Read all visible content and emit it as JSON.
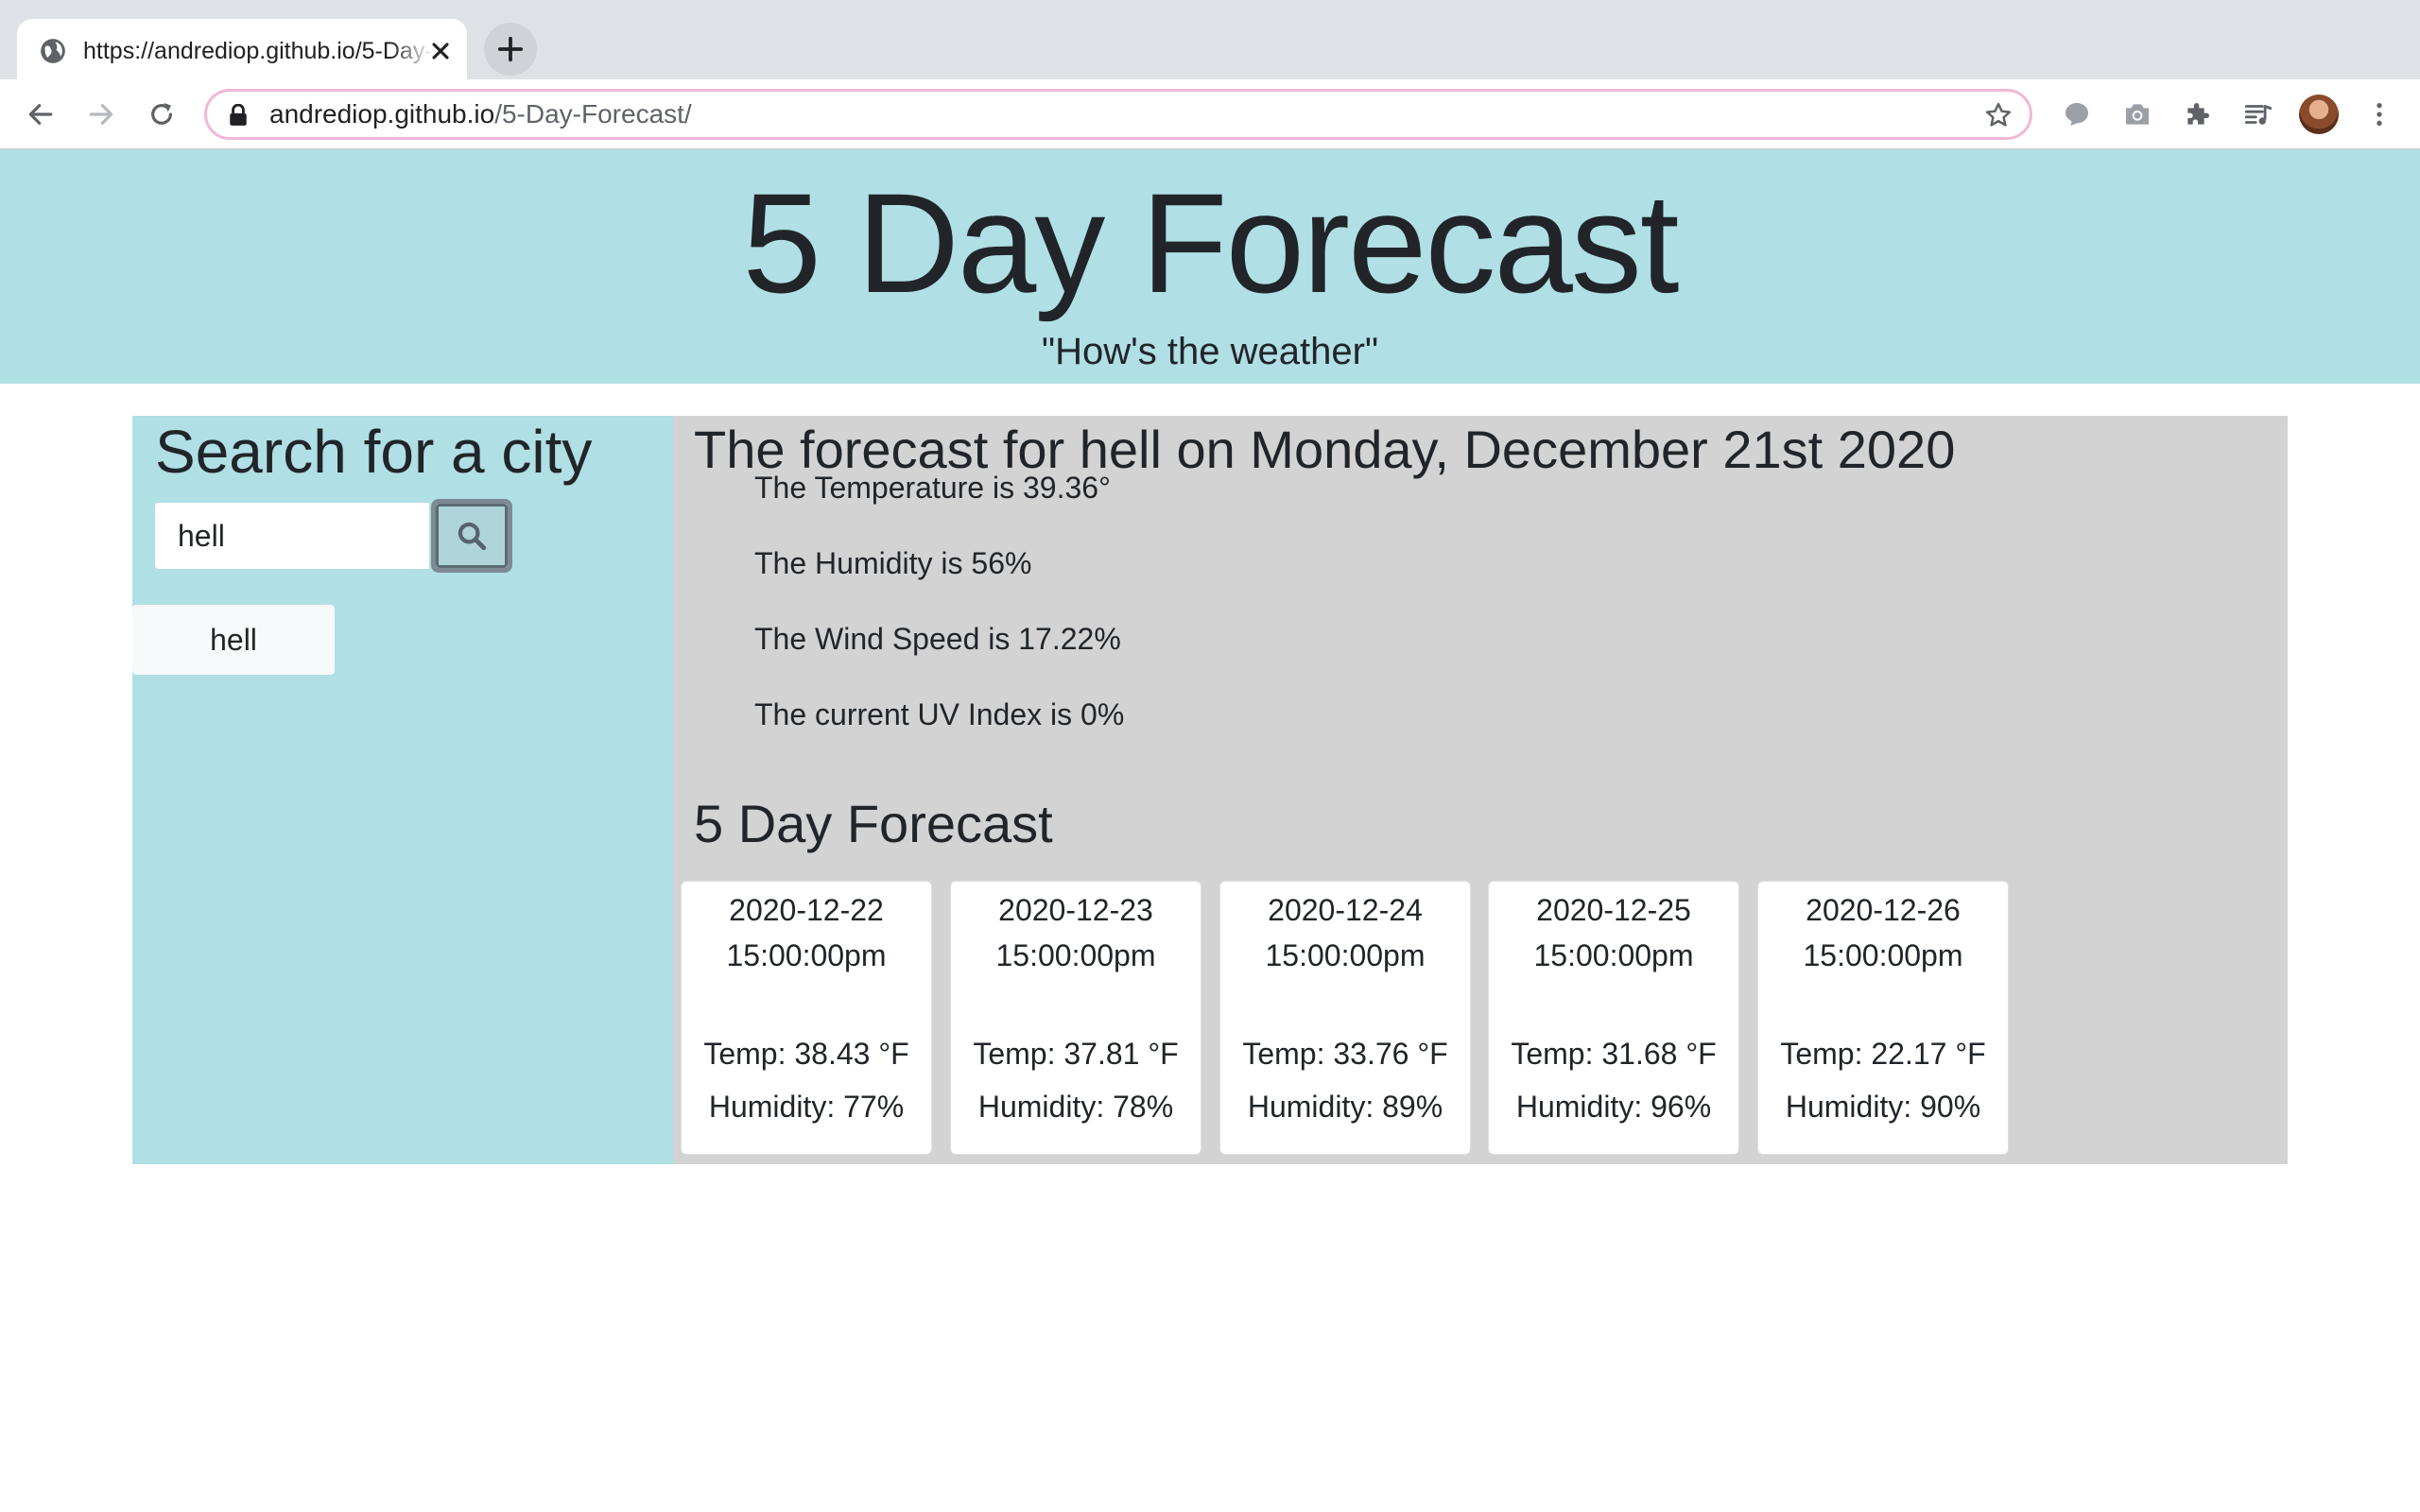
{
  "browser": {
    "tab_title": "https://andrediop.github.io/5-Day-Forecast/",
    "url_host": "andrediop.github.io",
    "url_path": "/5-Day-Forecast/"
  },
  "header": {
    "title": "5 Day Forecast",
    "subtitle": "\"How's the weather\""
  },
  "sidebar": {
    "heading": "Search for a city",
    "search_value": "hell",
    "history": [
      "hell"
    ]
  },
  "current": {
    "heading": "The forecast for hell on Monday, December 21st 2020",
    "temperature": "The Temperature is 39.36°",
    "humidity": "The Humidity is 56%",
    "wind": "The Wind Speed is 17.22%",
    "uv": "The current UV Index is 0%"
  },
  "forecast": {
    "heading": "5 Day Forecast",
    "days": [
      {
        "date": "2020-12-22",
        "time": "15:00:00pm",
        "temp": "Temp: 38.43 °F",
        "humidity": "Humidity: 77%"
      },
      {
        "date": "2020-12-23",
        "time": "15:00:00pm",
        "temp": "Temp: 37.81 °F",
        "humidity": "Humidity: 78%"
      },
      {
        "date": "2020-12-24",
        "time": "15:00:00pm",
        "temp": "Temp: 33.76 °F",
        "humidity": "Humidity: 89%"
      },
      {
        "date": "2020-12-25",
        "time": "15:00:00pm",
        "temp": "Temp: 31.68 °F",
        "humidity": "Humidity: 96%"
      },
      {
        "date": "2020-12-26",
        "time": "15:00:00pm",
        "temp": "Temp: 22.17 °F",
        "humidity": "Humidity: 90%"
      }
    ]
  },
  "colors": {
    "jumbotron_bg": "#b0dfe5",
    "main_bg": "#d3d3d3",
    "card_bg": "#ffffff",
    "text": "#212529"
  },
  "icons": [
    "globe-icon",
    "close-icon",
    "plus-icon",
    "back-arrow-icon",
    "forward-arrow-icon",
    "reload-icon",
    "lock-icon",
    "star-icon",
    "search-icon",
    "extensions-icon",
    "media-icon",
    "camera-icon",
    "speech-bubble-icon"
  ]
}
